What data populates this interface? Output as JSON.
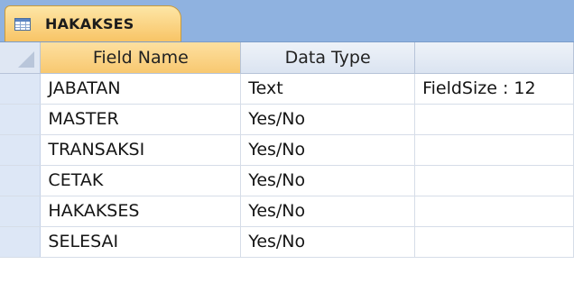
{
  "tab": {
    "label": "HAKAKSES",
    "icon": "table-icon"
  },
  "columns": [
    "Field Name",
    "Data Type",
    ""
  ],
  "rows": [
    {
      "field": "JABATAN",
      "type": "Text",
      "props": "FieldSize : 12"
    },
    {
      "field": "MASTER",
      "type": "Yes/No",
      "props": ""
    },
    {
      "field": "TRANSAKSI",
      "type": "Yes/No",
      "props": ""
    },
    {
      "field": "CETAK",
      "type": "Yes/No",
      "props": ""
    },
    {
      "field": "HAKAKSES",
      "type": "Yes/No",
      "props": ""
    },
    {
      "field": "SELESAI",
      "type": "Yes/No",
      "props": ""
    }
  ],
  "colors": {
    "tabbar": "#8fb2e0",
    "tab": "#f8c466",
    "selector": "#dde7f6"
  }
}
